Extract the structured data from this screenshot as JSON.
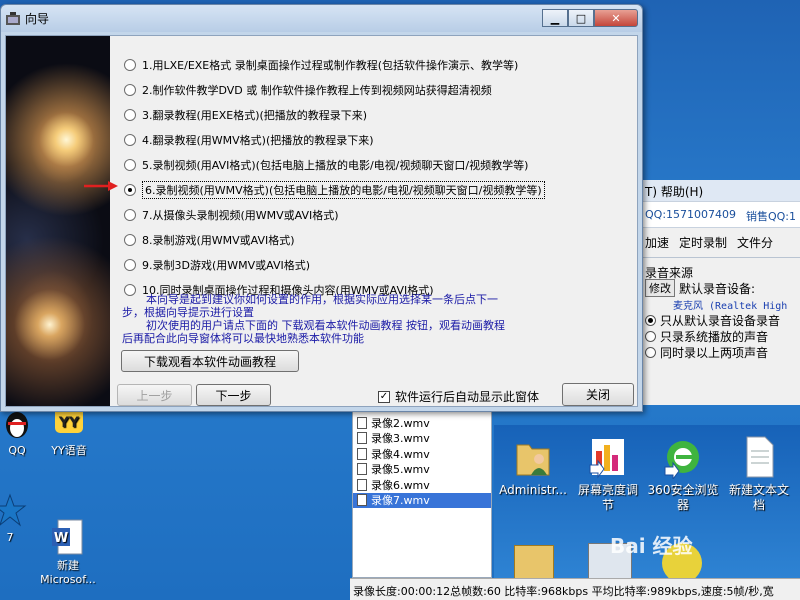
{
  "wizard": {
    "title": "向导",
    "options": [
      "1.用LXE/EXE格式 录制桌面操作过程或制作教程(包括软件操作演示、教学等)",
      "2.制作软件教学DVD 或 制作软件操作教程上传到视频网站获得超清视频",
      "3.翻录教程(用EXE格式)(把播放的教程录下来)",
      "4.翻录教程(用WMV格式)(把播放的教程录下来)",
      "5.录制视频(用AVI格式)(包括电脑上播放的电影/电视/视频聊天窗口/视频教学等)",
      "6.录制视频(用WMV格式)(包括电脑上播放的电影/电视/视频聊天窗口/视频教学等)",
      "7.从摄像头录制视频(用WMV或AVI格式)",
      "8.录制游戏(用WMV或AVI格式)",
      "9.录制3D游戏(用WMV或AVI格式)",
      "10.同时录制桌面操作过程和摄像头内容(用WMV或AVI格式)"
    ],
    "selected_option": 6,
    "info_line1": "本向导是起到建议你如何设置的作用，根据实际应用选择某一条后点下一步，根据向导提示进行设置",
    "info_line2": "初次使用的用户请点下面的 下载观看本软件动画教程 按钮，观看动画教程后再配合此向导窗体将可以最快地熟悉本软件功能",
    "download_button": "下载观看本软件动画教程",
    "prev_button": "上一步",
    "next_button": "下一步",
    "autoshow_label": "软件运行后自动显示此窗体",
    "autoshow_checked": true,
    "close_button": "关闭",
    "minimize_glyph": "▁",
    "maximize_glyph": "□",
    "close_glyph": "✕"
  },
  "background_app": {
    "menu_fragment": "T)  帮助(H)",
    "qq_label": "QQ:1571007409",
    "sales_qq": "销售QQ:1",
    "tabs": [
      "加速",
      "定时录制",
      "文件分"
    ],
    "audio_source_title": "录音来源",
    "modify_button": "修改",
    "default_device_label": "默认录音设备:",
    "device_name": "麦克风 (Realtek High",
    "audio_options": [
      "只从默认录音设备录音",
      "只录系统播放的声音",
      "同时录以上两项声音"
    ],
    "audio_selected": 0
  },
  "desktop_icons": [
    {
      "label": "QQ"
    },
    {
      "label": "YY语音"
    },
    {
      "label": "7"
    },
    {
      "label": "新建\nMicrosof..."
    }
  ],
  "file_list": {
    "items": [
      "录像2.wmv",
      "录像3.wmv",
      "录像4.wmv",
      "录像5.wmv",
      "录像6.wmv",
      "录像7.wmv"
    ],
    "selected": "录像7.wmv"
  },
  "explorer": {
    "icons": [
      {
        "label": "Administr...",
        "icon": "user-folder-icon"
      },
      {
        "label": "屏幕亮度调\n节",
        "icon": "brightness-chart-icon"
      },
      {
        "label": "360安全浏览\n器",
        "icon": "browser-icon"
      },
      {
        "label": "新建文本文\n档",
        "icon": "text-document-icon"
      }
    ]
  },
  "status_bar": "录像长度:00:00:12总帧数:60 比特率:968kbps 平均比特率:989kbps,速度:5帧/秒,宽",
  "watermark": "Bai 经验",
  "colors": {
    "info_text": "#1a1aa6",
    "arrow": "#e02020",
    "desktop": "#1f63b4"
  }
}
